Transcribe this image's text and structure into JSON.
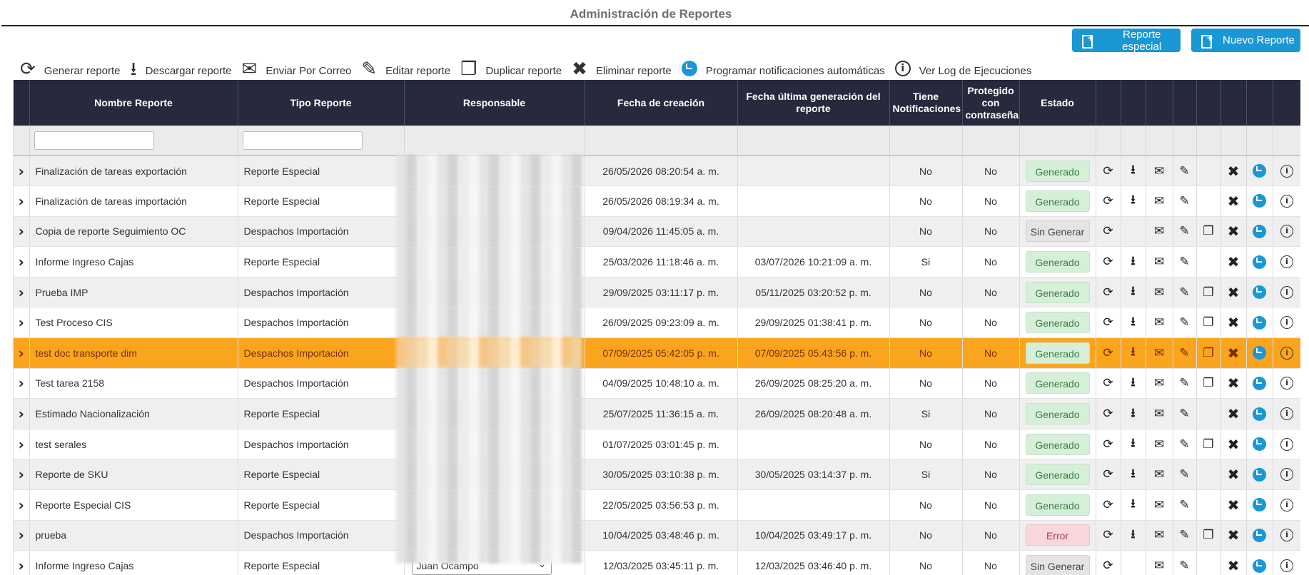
{
  "page": {
    "title": "Administración de Reportes"
  },
  "top_buttons": {
    "special": "Reporte especial",
    "new": "Nuevo Reporte"
  },
  "toolbar": [
    {
      "label": "Generar reporte",
      "icon": "refresh-icon",
      "glyph": "⟳"
    },
    {
      "label": "Descargar reporte",
      "icon": "download-icon",
      "glyph": "⭳"
    },
    {
      "label": "Enviar Por Correo",
      "icon": "send-email-icon",
      "glyph": "✉"
    },
    {
      "label": "Editar reporte",
      "icon": "edit-icon",
      "glyph": "✎"
    },
    {
      "label": "Duplicar reporte",
      "icon": "duplicate-icon",
      "glyph": "❐"
    },
    {
      "label": "Eliminar reporte",
      "icon": "delete-icon",
      "glyph": "✖"
    },
    {
      "label": "Programar notificaciones automáticas",
      "icon": "schedule-clock-icon",
      "glyph": ""
    },
    {
      "label": "Ver Log de Ejecuciones",
      "icon": "info-icon",
      "glyph": "i"
    }
  ],
  "table": {
    "headers": {
      "name": "Nombre Reporte",
      "type": "Tipo Reporte",
      "owner": "Responsable",
      "created": "Fecha de creación",
      "last_generated": "Fecha última generación del reporte",
      "notifications": "Tiene Notificaciones",
      "protected": "Protegido con contraseña",
      "status": "Estado"
    },
    "colors": {
      "selected_row": "#fba51f",
      "header_bg": "#262a3c",
      "accent": "#1998d5"
    },
    "rows": [
      {
        "name": "Finalización de tareas exportación",
        "type": "Reporte Especial",
        "created": "26/05/2026 08:20:54 a. m.",
        "last": "",
        "notif": "No",
        "prot": "No",
        "status": "Generado",
        "status_kind": "ok",
        "download": true,
        "duplicate": false
      },
      {
        "name": "Finalización de tareas importación",
        "type": "Reporte Especial",
        "created": "26/05/2026 08:19:34 a. m.",
        "last": "",
        "notif": "No",
        "prot": "No",
        "status": "Generado",
        "status_kind": "ok",
        "download": true,
        "duplicate": false
      },
      {
        "name": "Copia de reporte Seguimiento OC",
        "type": "Despachos Importación",
        "created": "09/04/2026 11:45:05 a. m.",
        "last": "",
        "notif": "No",
        "prot": "No",
        "status": "Sin Generar",
        "status_kind": "none",
        "download": false,
        "duplicate": true
      },
      {
        "name": "Informe Ingreso Cajas",
        "type": "Reporte Especial",
        "created": "25/03/2026 11:18:46 a. m.",
        "last": "03/07/2026 10:21:09 a. m.",
        "notif": "Si",
        "prot": "No",
        "status": "Generado",
        "status_kind": "ok",
        "download": true,
        "duplicate": false
      },
      {
        "name": "Prueba IMP",
        "type": "Despachos Importación",
        "created": "29/09/2025 03:11:17 p. m.",
        "last": "05/11/2025 03:20:52 p. m.",
        "notif": "No",
        "prot": "No",
        "status": "Generado",
        "status_kind": "ok",
        "download": true,
        "duplicate": true
      },
      {
        "name": "Test Proceso CIS",
        "type": "Despachos Importación",
        "created": "26/09/2025 09:23:09 a. m.",
        "last": "29/09/2025 01:38:41 p. m.",
        "notif": "No",
        "prot": "No",
        "status": "Generado",
        "status_kind": "ok",
        "download": true,
        "duplicate": true
      },
      {
        "name": "test doc transporte dim",
        "type": "Despachos Importación",
        "created": "07/09/2025 05:42:05 p. m.",
        "last": "07/09/2025 05:43:56 p. m.",
        "notif": "No",
        "prot": "No",
        "status": "Generado",
        "status_kind": "ok",
        "download": true,
        "duplicate": true,
        "selected": true
      },
      {
        "name": "Test tarea 2158",
        "type": "Despachos Importación",
        "created": "04/09/2025 10:48:10 a. m.",
        "last": "26/09/2025 08:25:20 a. m.",
        "notif": "No",
        "prot": "No",
        "status": "Generado",
        "status_kind": "ok",
        "download": true,
        "duplicate": true
      },
      {
        "name": "Estimado Nacionalización",
        "type": "Reporte Especial",
        "created": "25/07/2025 11:36:15 a. m.",
        "last": "26/09/2025 08:20:48 a. m.",
        "notif": "Si",
        "prot": "No",
        "status": "Generado",
        "status_kind": "ok",
        "download": true,
        "duplicate": false
      },
      {
        "name": "test serales",
        "type": "Despachos Importación",
        "created": "01/07/2025 03:01:45 p. m.",
        "last": "",
        "notif": "No",
        "prot": "No",
        "status": "Generado",
        "status_kind": "ok",
        "download": true,
        "duplicate": true
      },
      {
        "name": "Reporte de SKU",
        "type": "Reporte Especial",
        "created": "30/05/2025 03:10:38 p. m.",
        "last": "30/05/2025 03:14:37 p. m.",
        "notif": "Si",
        "prot": "No",
        "status": "Generado",
        "status_kind": "ok",
        "download": true,
        "duplicate": false
      },
      {
        "name": "Reporte Especial CIS",
        "type": "Reporte Especial",
        "created": "22/05/2025 03:56:53 p. m.",
        "last": "",
        "notif": "No",
        "prot": "No",
        "status": "Generado",
        "status_kind": "ok",
        "download": true,
        "duplicate": false
      },
      {
        "name": "prueba",
        "type": "Despachos Importación",
        "created": "10/04/2025 03:48:46 p. m.",
        "last": "10/04/2025 03:49:17 p. m.",
        "notif": "No",
        "prot": "No",
        "status": "Error",
        "status_kind": "err",
        "download": true,
        "duplicate": true
      },
      {
        "name": "Informe Ingreso Cajas",
        "type": "Reporte Especial",
        "created": "12/03/2025 03:45:11 p. m.",
        "last": "12/03/2025 03:46:40 p. m.",
        "notif": "No",
        "prot": "No",
        "status": "Sin Generar",
        "status_kind": "none",
        "download": false,
        "duplicate": false,
        "owner_text": "Juan Ocampo"
      }
    ]
  }
}
